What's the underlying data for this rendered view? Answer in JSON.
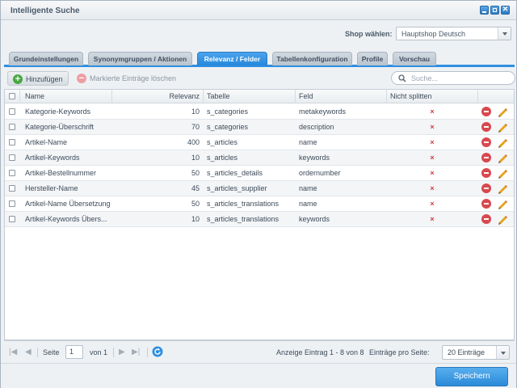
{
  "window": {
    "title": "Intelligente Suche"
  },
  "shop": {
    "label": "Shop wählen:",
    "selected": "Hauptshop Deutsch"
  },
  "tabs": [
    {
      "label": "Grundeinstellungen",
      "active": false
    },
    {
      "label": "Synonymgruppen / Aktionen",
      "active": false
    },
    {
      "label": "Relevanz / Felder",
      "active": true
    },
    {
      "label": "Tabellenkonfiguration",
      "active": false
    },
    {
      "label": "Profile",
      "active": false
    },
    {
      "label": "Vorschau",
      "active": false
    }
  ],
  "toolbar": {
    "add_label": "Hinzufügen",
    "delete_label": "Markierte Einträge löschen",
    "search_placeholder": "Suche..."
  },
  "grid": {
    "columns": {
      "name": "Name",
      "relevance": "Relevanz",
      "table": "Tabelle",
      "field": "Feld",
      "no_split": "Nicht splitten"
    },
    "rows": [
      {
        "name": "Kategorie-Keywords",
        "relevance": "10",
        "table": "s_categories",
        "field": "metakeywords",
        "no_split": "×"
      },
      {
        "name": "Kategorie-Überschrift",
        "relevance": "70",
        "table": "s_categories",
        "field": "description",
        "no_split": "×"
      },
      {
        "name": "Artikel-Name",
        "relevance": "400",
        "table": "s_articles",
        "field": "name",
        "no_split": "×"
      },
      {
        "name": "Artikel-Keywords",
        "relevance": "10",
        "table": "s_articles",
        "field": "keywords",
        "no_split": "×"
      },
      {
        "name": "Artikel-Bestellnummer",
        "relevance": "50",
        "table": "s_articles_details",
        "field": "ordernumber",
        "no_split": "×"
      },
      {
        "name": "Hersteller-Name",
        "relevance": "45",
        "table": "s_articles_supplier",
        "field": "name",
        "no_split": "×"
      },
      {
        "name": "Artikel-Name Übersetzung",
        "relevance": "50",
        "table": "s_articles_translations",
        "field": "name",
        "no_split": "×"
      },
      {
        "name": "Artikel-Keywords Übers...",
        "relevance": "10",
        "table": "s_articles_translations",
        "field": "keywords",
        "no_split": "×"
      }
    ]
  },
  "pager": {
    "page_label": "Seite",
    "page_value": "1",
    "of_label": "von 1",
    "display_info": "Anzeige Eintrag 1 - 8 von 8",
    "per_page_label": "Einträge pro Seite:",
    "per_page_value": "20 Einträge"
  },
  "footer": {
    "save_label": "Speichern"
  },
  "colors": {
    "accent": "#2f8fe0",
    "delete_red": "#d9484d",
    "add_green": "#49a842",
    "edit_orange": "#e8a21a"
  }
}
